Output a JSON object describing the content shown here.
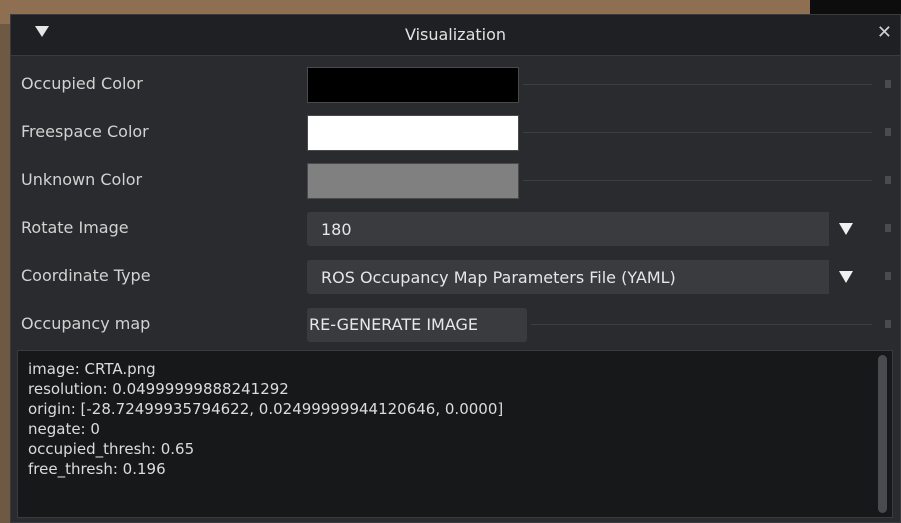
{
  "window": {
    "title": "Visualization",
    "collapse_icon": "triangle-down-icon",
    "close_icon": "close-icon",
    "close_glyph": "✕"
  },
  "colors": {
    "occupied": "#000000",
    "freespace": "#ffffff",
    "unknown": "#808080"
  },
  "rows": {
    "occupied_color": {
      "label": "Occupied Color"
    },
    "freespace_color": {
      "label": "Freespace Color"
    },
    "unknown_color": {
      "label": "Unknown Color"
    },
    "rotate_image": {
      "label": "Rotate Image",
      "value": "180"
    },
    "coordinate_type": {
      "label": "Coordinate Type",
      "value": "ROS Occupancy Map Parameters File (YAML)"
    },
    "occupancy_map": {
      "label": "Occupancy map",
      "button": "RE-GENERATE IMAGE"
    }
  },
  "yaml": {
    "lines": [
      "image: CRTA.png",
      "resolution: 0.04999999888241292",
      "origin: [-28.72499935794622, 0.02499999944120646, 0.0000]",
      "negate: 0",
      "occupied_thresh: 0.65",
      "free_thresh: 0.196"
    ]
  }
}
